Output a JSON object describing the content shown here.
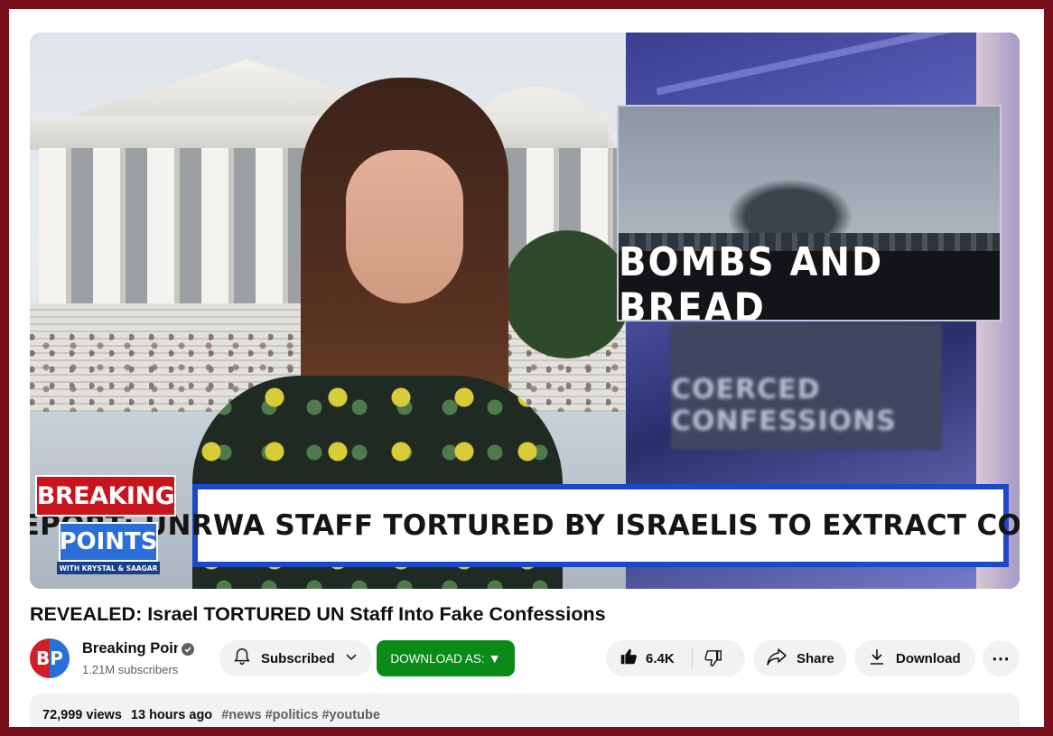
{
  "video": {
    "news_card_headline": "BOMBS AND BREAD",
    "blurred_headline": "COERCED CONFESSIONS",
    "lower_third": "REPORT: UNRWA STAFF TORTURED BY ISRAELIS TO EXTRACT CONFESSIONS",
    "logo_breaking": "BREAKING",
    "logo_points": "POINTS",
    "logo_subtitle": "WITH KRYSTAL & SAAGAR"
  },
  "title": "REVEALED: Israel TORTURED UN Staff Into Fake Confessions",
  "channel": {
    "avatar_text": "BP",
    "name": "Breaking Points",
    "subscribers": "1.21M subscribers"
  },
  "actions": {
    "subscribe_label": "Subscribed",
    "download_as_label": "DOWNLOAD AS:",
    "download_as_arrow": "▼",
    "like_count": "6.4K",
    "share_label": "Share",
    "download_label": "Download",
    "more_label": "⋯"
  },
  "description": {
    "views": "72,999 views",
    "time_ago": "13 hours ago",
    "tags": [
      "#news",
      "#politics",
      "#youtube"
    ]
  },
  "colors": {
    "border": "#7a0f1c",
    "download_as_bg": "#0a8a16",
    "pill_bg": "#f2f2f2",
    "lower_third_border": "#1c49c9"
  }
}
